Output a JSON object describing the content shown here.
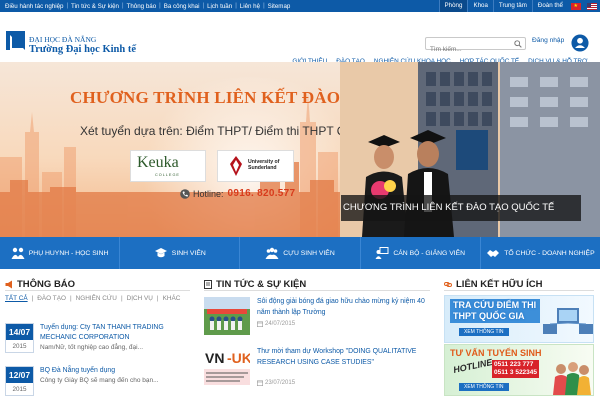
{
  "topbar": {
    "left_links": [
      "Điều hành tác nghiệp",
      "Tin tức & Sự kiện",
      "Thông báo",
      "Ba công khai",
      "Lịch tuần",
      "Liên hệ",
      "Sitemap"
    ],
    "right_links": [
      "Phòng",
      "Khoa",
      "Trung tâm",
      "Đoàn thể"
    ]
  },
  "header": {
    "logo_line1": "ĐẠI HỌC ĐÀ NẴNG",
    "logo_line2": "Trường Đại học Kinh tế",
    "search_placeholder": "Tìm kiếm...",
    "login": "Đăng nhập",
    "nav": [
      "GIỚI THIỆU",
      "ĐÀO TẠO",
      "NGHIÊN CỨU KHOA HỌC",
      "HỢP TÁC QUỐC TẾ",
      "DỊCH VỤ & HỖ TRỢ"
    ]
  },
  "hero": {
    "title": "CHƯƠNG TRÌNH LIÊN KẾT ĐÀO TẠO QUỐC TẾ",
    "subtitle": "Xét tuyển dựa trên: Điểm THPT/ Điểm thi THPT Quốc gia",
    "partner1": "Keuka",
    "partner1_sub": "COLLEGE",
    "partner2_line1": "University of",
    "partner2_line2": "Sunderland",
    "hotline_label": "Hotline:",
    "hotline_value": "0916. 820.577",
    "caption": "CHƯƠNG TRÌNH LIÊN KẾT ĐÀO TẠO QUỐC TẾ"
  },
  "audience": [
    "PHỤ HUYNH - HỌC SINH",
    "SINH VIÊN",
    "CỰU SINH VIÊN",
    "CÁN BỘ - GIẢNG VIÊN",
    "TỔ CHỨC - DOANH NGHIỆP"
  ],
  "notices": {
    "title": "THÔNG BÁO",
    "filters": [
      "TẤT CẢ",
      "ĐÀO TẠO",
      "NGHIÊN CỨU",
      "DỊCH VỤ",
      "KHÁC"
    ],
    "items": [
      {
        "day": "14/07",
        "year": "2015",
        "title": "Tuyển dụng: Cty TAN THANH TRADING MECHANIC CORPORATION",
        "snippet": "Nam/Nữ, tốt nghiệp cao đẳng, đại..."
      },
      {
        "day": "12/07",
        "year": "2015",
        "title": "BQ Đà Nẵng tuyển dụng",
        "snippet": "Công ty Giày BQ sẽ mang đến cho bạn..."
      }
    ]
  },
  "news": {
    "title": "TIN TỨC & SỰ KIỆN",
    "items": [
      {
        "title": "Sôi động giải bóng đá giao hữu chào mừng kỷ niệm 40 năm thành lập Trường",
        "date": "24/07/2015"
      },
      {
        "title": "Thư mời tham dự Workshop \"DOING QUALITATIVE RESEARCH USING CASE STUDIES\"",
        "date": "23/07/2015"
      }
    ]
  },
  "links": {
    "title": "LIÊN KẾT HỮU ÍCH",
    "banner1_text": "TRA CỨU ĐIỂM THI THPT QUỐC GIA",
    "banner2_title": "TƯ VẤN TUYỂN SINH",
    "banner2_hot": "HOTLINE",
    "banner2_num1": "0511 223 777",
    "banner2_num2": "0511 3 522345",
    "more_label": "XEM THÔNG TIN"
  },
  "colors": {
    "primary": "#0d5aa7",
    "audience_bar": "#1c6fc2",
    "hero_title": "#e0611e",
    "hotline": "#d83b1c"
  }
}
